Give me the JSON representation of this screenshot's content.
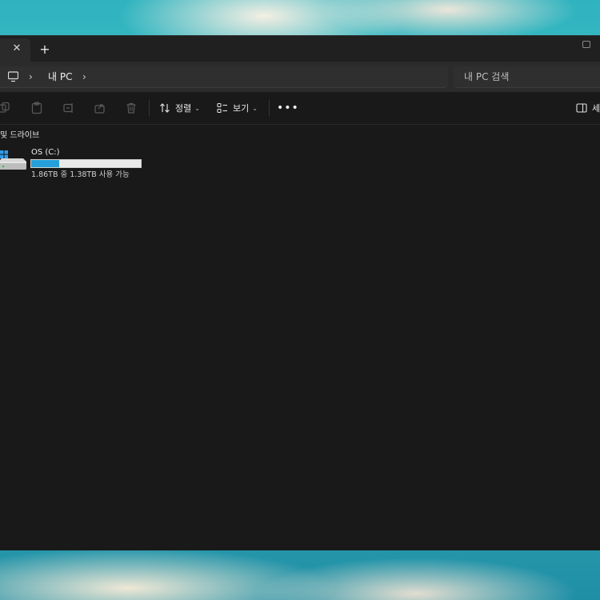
{
  "window": {
    "tab_close_glyph": "✕",
    "new_tab_glyph": "+"
  },
  "address": {
    "breadcrumb": [
      "내 PC"
    ],
    "search_placeholder": "내 PC 검색"
  },
  "commandbar": {
    "sort_label": "정렬",
    "view_label": "보기",
    "more_glyph": "•••",
    "details_label": "세"
  },
  "content": {
    "group_header": "및 드라이브",
    "drives": [
      {
        "name": "OS (C:)",
        "free_text": "1.86TB 중 1.38TB 사용 가능",
        "used_fraction": 0.258,
        "bar_color": "#26a0da"
      }
    ]
  },
  "colors": {
    "window_bg": "#191919",
    "accent": "#26a0da"
  }
}
